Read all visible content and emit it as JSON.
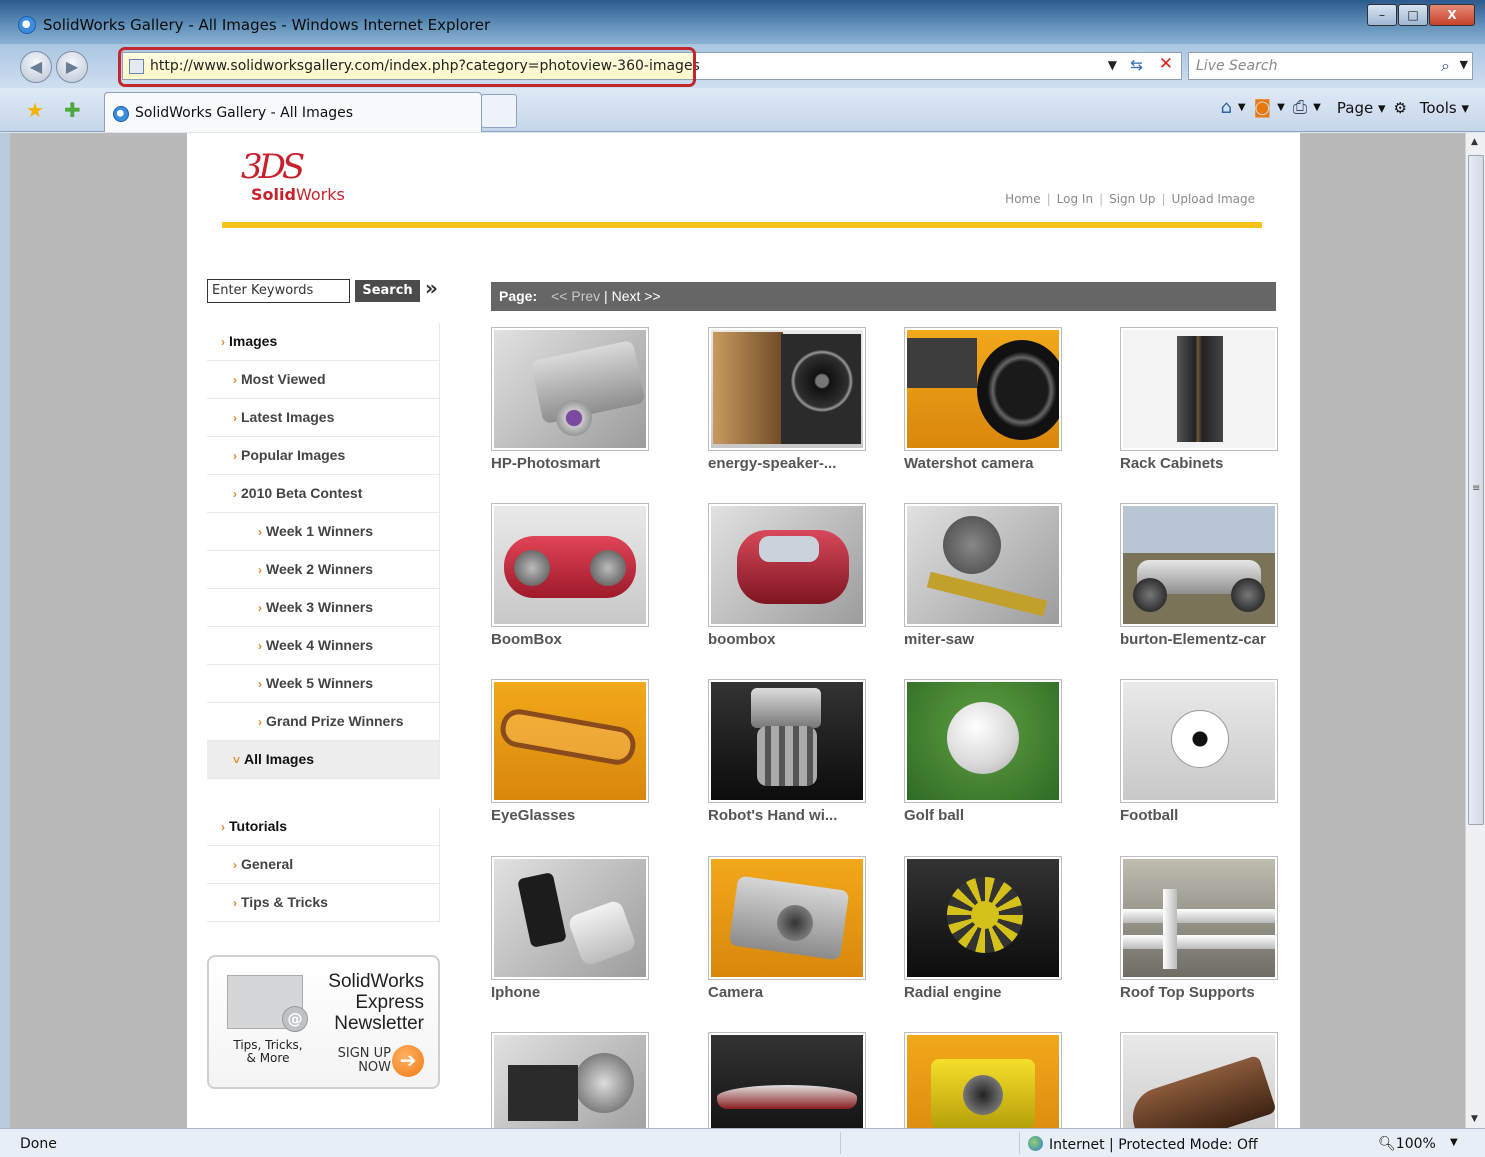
{
  "window": {
    "title": "SolidWorks Gallery - All Images - Windows Internet Explorer",
    "controls": {
      "minimize": "–",
      "maximize": "□",
      "close": "X"
    }
  },
  "addressbar": {
    "url": "http://www.solidworksgallery.com/index.php?category=photoview-360-images",
    "search_placeholder": "Live Search"
  },
  "tabs": [
    {
      "label": "SolidWorks Gallery - All Images"
    }
  ],
  "commandbar": {
    "page_label": "Page",
    "tools_label": "Tools"
  },
  "site": {
    "logo_mark": "3DS",
    "logo_solid": "Solid",
    "logo_works": "Works",
    "toplinks": [
      "Home",
      "Log In",
      "Sign Up",
      "Upload Image"
    ],
    "search": {
      "placeholder": "Enter Keywords",
      "button": "Search",
      "more": "»"
    },
    "nav": [
      {
        "label": "Images",
        "level": 0
      },
      {
        "label": "Most Viewed",
        "level": 1
      },
      {
        "label": "Latest Images",
        "level": 1
      },
      {
        "label": "Popular Images",
        "level": 1
      },
      {
        "label": "2010 Beta Contest",
        "level": 1
      },
      {
        "label": "Week 1 Winners",
        "level": 2
      },
      {
        "label": "Week 2 Winners",
        "level": 2
      },
      {
        "label": "Week 3 Winners",
        "level": 2
      },
      {
        "label": "Week 4 Winners",
        "level": 2
      },
      {
        "label": "Week 5 Winners",
        "level": 2
      },
      {
        "label": "Grand Prize Winners",
        "level": 2
      },
      {
        "label": "All Images",
        "level": 1,
        "active": true
      }
    ],
    "nav2": [
      {
        "label": "Tutorials",
        "level": 0
      },
      {
        "label": "General",
        "level": 1
      },
      {
        "label": "Tips & Tricks",
        "level": 1
      }
    ],
    "newsletter": {
      "title_1": "SolidWorks",
      "title_2": "Express",
      "title_3": "Newsletter",
      "tips_1": "Tips, Tricks,",
      "tips_2": "& More",
      "signup_1": "SIGN UP",
      "signup_2": "NOW"
    },
    "pager": {
      "label": "Page:",
      "prev": "<< Prev",
      "sep": " | ",
      "next": "Next >>"
    },
    "gallery": [
      {
        "caption": "HP-Photosmart",
        "icon": "camera-render"
      },
      {
        "caption": "energy-speaker-...",
        "icon": "speaker-render"
      },
      {
        "caption": "Watershot camera",
        "icon": "underwater-camera-render"
      },
      {
        "caption": "Rack Cabinets",
        "icon": "rack-render"
      },
      {
        "caption": "BoomBox",
        "icon": "boombox-render"
      },
      {
        "caption": "boombox",
        "icon": "boombox-render"
      },
      {
        "caption": "miter-saw",
        "icon": "saw-render"
      },
      {
        "caption": "burton-Elementz-car",
        "icon": "car-render"
      },
      {
        "caption": "EyeGlasses",
        "icon": "glasses-render"
      },
      {
        "caption": "Robot's Hand wi...",
        "icon": "robot-hand-render"
      },
      {
        "caption": "Golf ball",
        "icon": "golf-ball-render"
      },
      {
        "caption": "Football",
        "icon": "football-render"
      },
      {
        "caption": "Iphone",
        "icon": "phone-render"
      },
      {
        "caption": "Camera",
        "icon": "camera-render"
      },
      {
        "caption": "Radial engine",
        "icon": "engine-render"
      },
      {
        "caption": "Roof Top Supports",
        "icon": "pipes-render"
      },
      {
        "caption": "",
        "icon": "machine-render"
      },
      {
        "caption": "",
        "icon": "boat-render"
      },
      {
        "caption": "",
        "icon": "camera-render"
      },
      {
        "caption": "",
        "icon": "shoe-render"
      }
    ]
  },
  "statusbar": {
    "status": "Done",
    "zone": "Internet | Protected Mode: Off",
    "zoom": "100%"
  }
}
